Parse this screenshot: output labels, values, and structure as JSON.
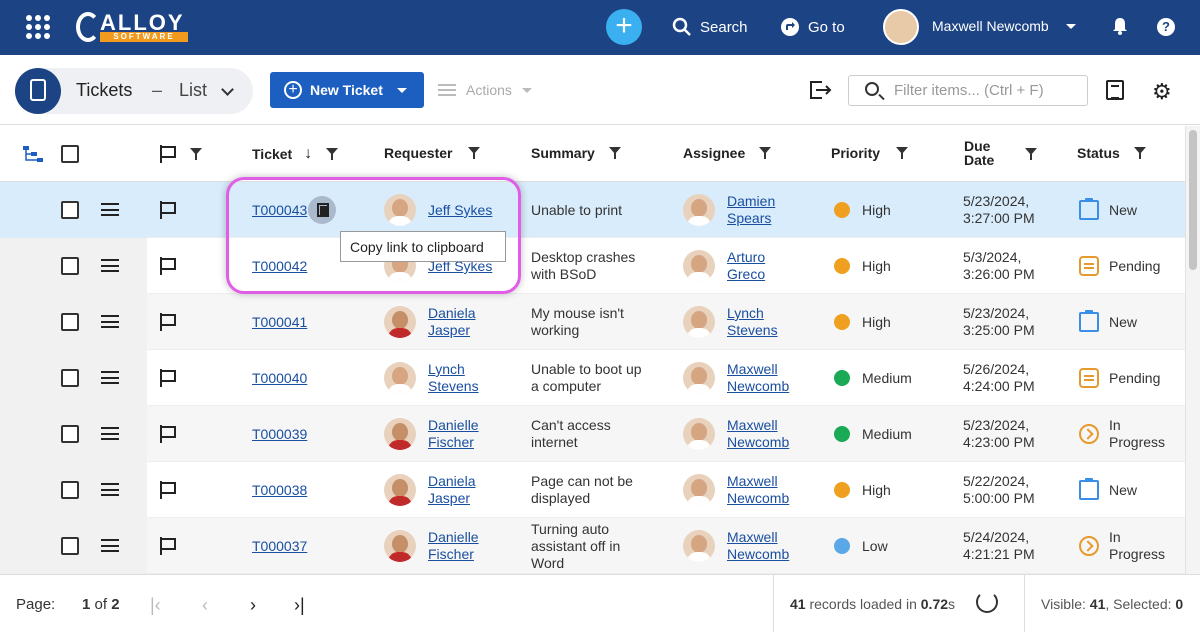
{
  "topbar": {
    "brand": "ALLOY",
    "brand_sub": "SOFTWARE",
    "search_label": "Search",
    "goto_label": "Go to",
    "user_name": "Maxwell Newcomb",
    "help_label": "?"
  },
  "toolbar": {
    "crumb_module": "Tickets",
    "crumb_sep": "–",
    "crumb_view": "List",
    "new_ticket_label": "New Ticket",
    "actions_label": "Actions",
    "filter_placeholder": "Filter items... (Ctrl + F)"
  },
  "columns": {
    "ticket": "Ticket",
    "requester": "Requester",
    "summary": "Summary",
    "assignee": "Assignee",
    "priority": "Priority",
    "due_l1": "Due",
    "due_l2": "Date",
    "status": "Status"
  },
  "priority_colors": {
    "High": "#f0a020",
    "Medium": "#1aaa55",
    "Low": "#5aa8e8"
  },
  "rows": [
    {
      "id": "T000043",
      "req1": "Jeff Sykes",
      "req2": "",
      "sum1": "Unable to print",
      "sum2": "",
      "sum3": "",
      "asg1": "Damien",
      "asg2": "Spears",
      "priority": "High",
      "due1": "5/23/2024,",
      "due2": "3:27:00 PM",
      "status1": "New",
      "status2": ""
    },
    {
      "id": "T000042",
      "req1": "Jeff Sykes",
      "req2": "",
      "sum1": "Desktop crashes",
      "sum2": "with BSoD",
      "sum3": "",
      "asg1": "Arturo",
      "asg2": "Greco",
      "priority": "High",
      "due1": "5/3/2024,",
      "due2": "3:26:00 PM",
      "status1": "Pending",
      "status2": ""
    },
    {
      "id": "T000041",
      "req1": "Daniela",
      "req2": "Jasper",
      "sum1": "My mouse isn't",
      "sum2": "working",
      "sum3": "",
      "asg1": "Lynch",
      "asg2": "Stevens",
      "priority": "High",
      "due1": "5/23/2024,",
      "due2": "3:25:00 PM",
      "status1": "New",
      "status2": ""
    },
    {
      "id": "T000040",
      "req1": "Lynch",
      "req2": "Stevens",
      "sum1": "Unable to boot up",
      "sum2": "a computer",
      "sum3": "",
      "asg1": "Maxwell",
      "asg2": "Newcomb",
      "priority": "Medium",
      "due1": "5/26/2024,",
      "due2": "4:24:00 PM",
      "status1": "Pending",
      "status2": ""
    },
    {
      "id": "T000039",
      "req1": "Danielle",
      "req2": "Fischer",
      "sum1": "Can't access",
      "sum2": "internet",
      "sum3": "",
      "asg1": "Maxwell",
      "asg2": "Newcomb",
      "priority": "Medium",
      "due1": "5/23/2024,",
      "due2": "4:23:00 PM",
      "status1": "In",
      "status2": "Progress"
    },
    {
      "id": "T000038",
      "req1": "Daniela",
      "req2": "Jasper",
      "sum1": "Page can not be",
      "sum2": "displayed",
      "sum3": "",
      "asg1": "Maxwell",
      "asg2": "Newcomb",
      "priority": "High",
      "due1": "5/22/2024,",
      "due2": "5:00:00 PM",
      "status1": "New",
      "status2": ""
    },
    {
      "id": "T000037",
      "req1": "Danielle",
      "req2": "Fischer",
      "sum1": "Turning auto",
      "sum2": "assistant off in",
      "sum3": "Word",
      "asg1": "Maxwell",
      "asg2": "Newcomb",
      "priority": "Low",
      "due1": "5/24/2024,",
      "due2": "4:21:21 PM",
      "status1": "In",
      "status2": "Progress"
    }
  ],
  "tooltip": "Copy link to clipboard",
  "footer": {
    "page_label": "Page:",
    "page_current": "1",
    "page_of": "of",
    "page_total": "2",
    "records_count": "41",
    "records_text": "records loaded in",
    "records_time": "0.72",
    "records_unit": "s",
    "visible_label": "Visible:",
    "visible_count": "41",
    "selected_label": ", Selected:",
    "selected_count": "0"
  }
}
